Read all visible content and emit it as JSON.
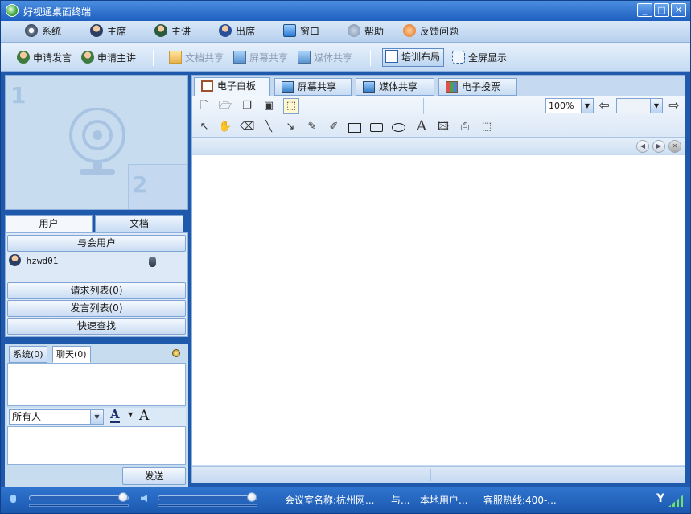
{
  "window": {
    "title": "好视通桌面终端"
  },
  "menu": [
    "系统",
    "主席",
    "主讲",
    "出席",
    "窗口",
    "帮助",
    "反馈问题"
  ],
  "toolbar": {
    "request_speak": "申请发言",
    "request_host": "申请主讲",
    "doc_share": "文档共享",
    "screen_share": "屏幕共享",
    "media_share": "媒体共享",
    "training_layout": "培训布局",
    "fullscreen": "全屏显示"
  },
  "video": {
    "slot1": "1",
    "slot2": "2"
  },
  "left_tabs": {
    "users": "用户",
    "docs": "文档"
  },
  "users_panel": {
    "attendees": "与会用户",
    "user": "hzwd01",
    "request_list": "请求列表(0)",
    "speak_list": "发言列表(0)",
    "quick_find": "快速查找"
  },
  "chat": {
    "tab_system": "系统(0)",
    "tab_chat": "聊天(0)",
    "recipient": "所有人",
    "send": "发送"
  },
  "content_tabs": [
    "电子白板",
    "屏幕共享",
    "媒体共享",
    "电子投票"
  ],
  "whiteboard": {
    "zoom": "100%"
  },
  "status": {
    "room": "会议室名称:杭州网...",
    "with": "与...",
    "local_users": "本地用户...",
    "hotline": "客服热线:400-..."
  },
  "colors": {
    "accent": "#1f59ab",
    "panel": "#c8dcf0"
  }
}
